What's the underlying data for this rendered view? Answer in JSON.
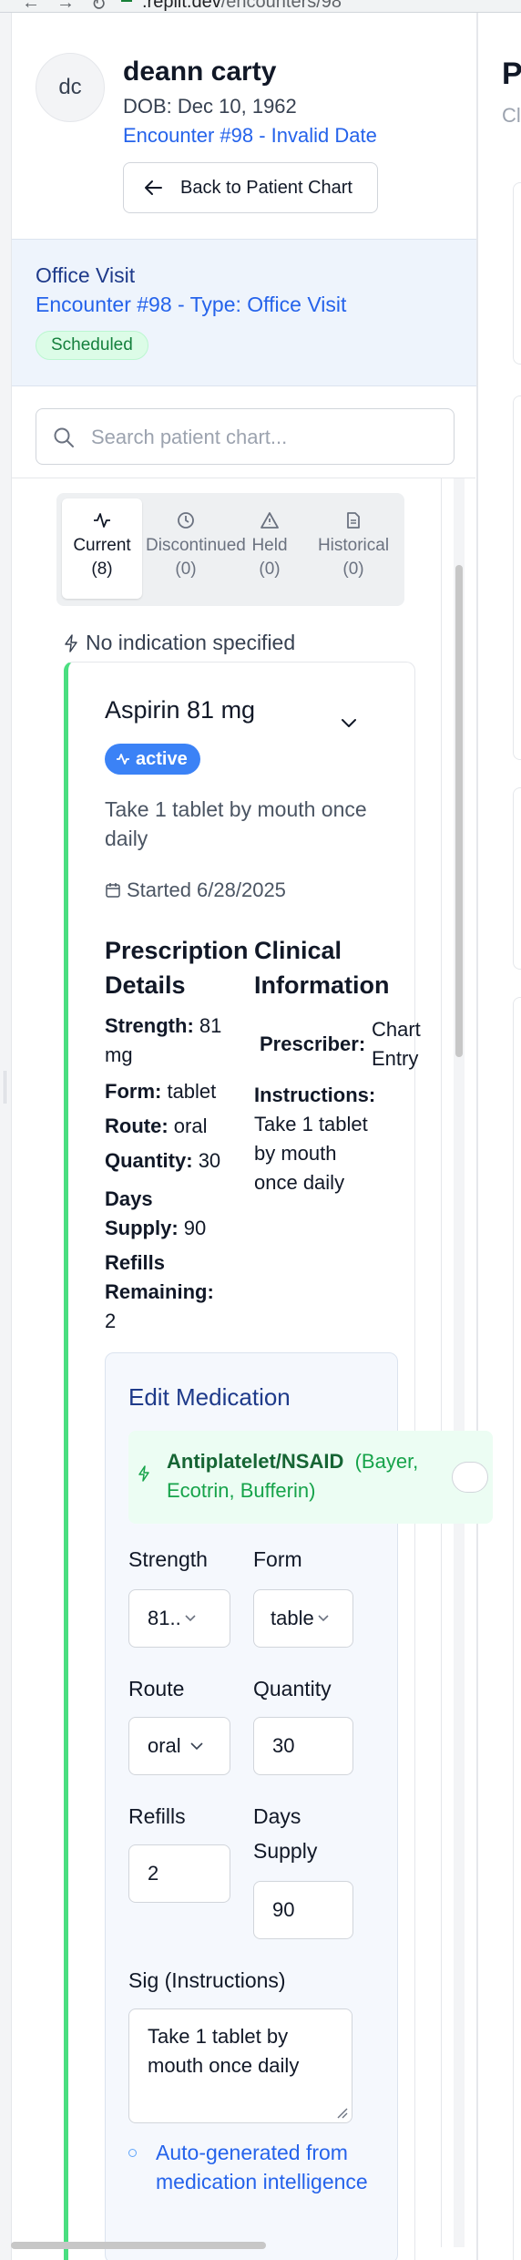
{
  "browser": {
    "url_host": ".replit.dev",
    "url_path": "/encounters/98"
  },
  "patient": {
    "initials": "dc",
    "name": "deann carty",
    "dob": "DOB: Dec 10, 1962",
    "encounter_link": "Encounter #98 - Invalid Date",
    "back_button": "Back to Patient Chart"
  },
  "visit": {
    "type": "Office Visit",
    "encounter": "Encounter #98 - Type: Office Visit",
    "status": "Scheduled"
  },
  "search": {
    "placeholder": "Search patient chart..."
  },
  "tabs": [
    {
      "label": "Current",
      "count": "(8)",
      "active": true
    },
    {
      "label": "Discontinued",
      "count": "(0)",
      "active": false
    },
    {
      "label": "Held",
      "count": "(0)",
      "active": false
    },
    {
      "label": "Historical",
      "count": "(0)",
      "active": false
    }
  ],
  "indication": "No indication specified",
  "medication": {
    "name": "Aspirin 81 mg",
    "status": "active",
    "sig": "Take 1 tablet by mouth once daily",
    "started": "Started 6/28/2025",
    "prescription_title_1": "Prescription",
    "prescription_title_2": "Details",
    "clinical_title_1": "Clinical",
    "clinical_title_2": "Information",
    "details": {
      "strength_key": "Strength:",
      "strength_val_1": "81",
      "strength_val_2": "mg",
      "form_key": "Form:",
      "form_val": "tablet",
      "route_key": "Route:",
      "route_val": "oral",
      "quantity_key": "Quantity:",
      "quantity_val": "30",
      "days_key_1": "Days",
      "days_key_2": "Supply:",
      "days_val": "90",
      "refills_key_1": "Refills",
      "refills_key_2": "Remaining:",
      "refills_val": "2"
    },
    "clinical": {
      "prescriber_key": "Prescriber:",
      "prescriber_val_1": "Chart",
      "prescriber_val_2": "Entry",
      "instructions_key": "Instructions:",
      "instructions_val_1": "Take 1 tablet",
      "instructions_val_2": "by mouth",
      "instructions_val_3": "once daily"
    }
  },
  "edit": {
    "title": "Edit Medication",
    "class_name": "Antiplatelet/NSAID",
    "class_brands": "(Bayer, Ecotrin, Bufferin)",
    "strength_label": "Strength",
    "strength_value": "81..",
    "form_label": "Form",
    "form_value": "table",
    "route_label": "Route",
    "route_value": "oral",
    "quantity_label": "Quantity",
    "quantity_value": "30",
    "refills_label": "Refills",
    "refills_value": "2",
    "days_label_1": "Days",
    "days_label_2": "Supply",
    "days_value": "90",
    "sig_label": "Sig (Instructions)",
    "sig_value": "Take 1 tablet by mouth once daily",
    "auto_note": "Auto-generated from medication intelligence"
  },
  "right_panel": {
    "title_fragment": "P",
    "subtitle_fragment": "Cl"
  },
  "colors": {
    "accent_blue": "#2563eb",
    "active_badge": "#3b82f6",
    "card_stripe": "#4ade80",
    "scheduled_bg": "#dcfce7"
  }
}
